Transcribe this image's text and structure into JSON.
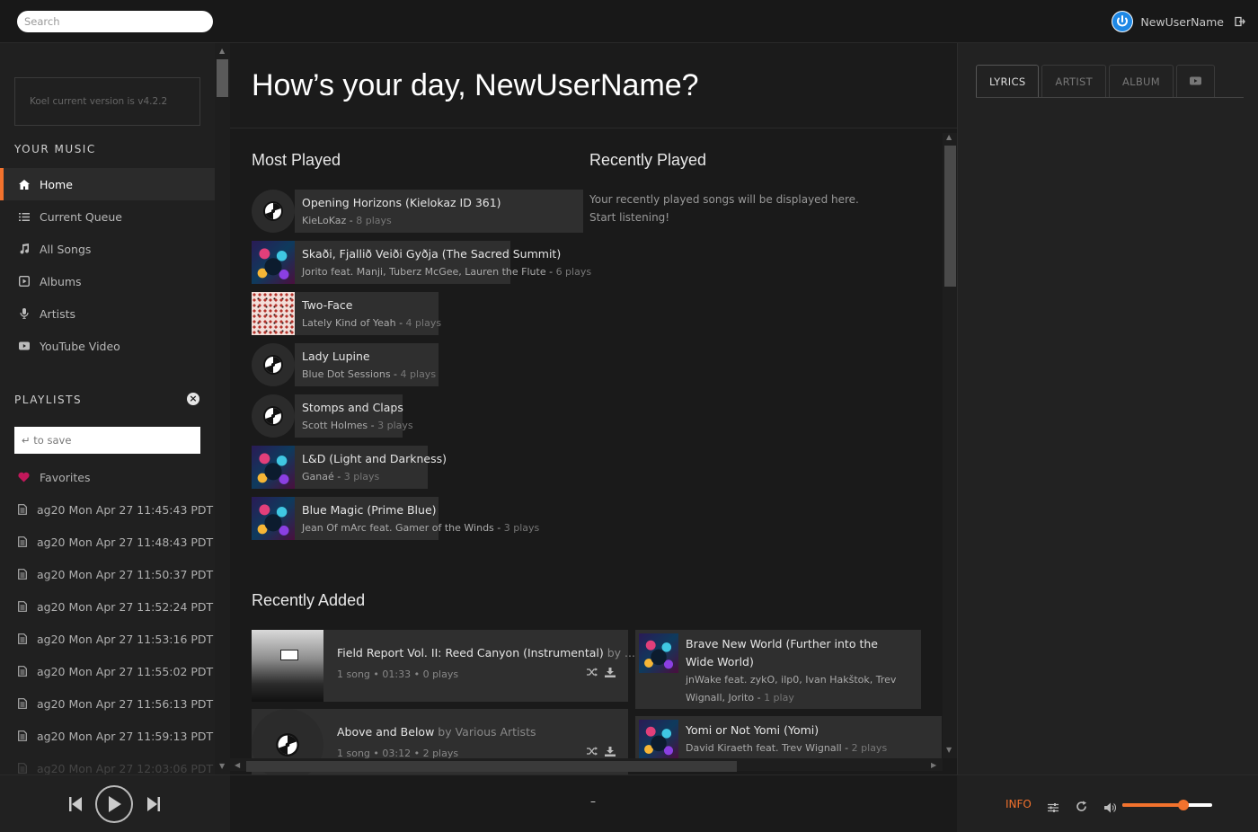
{
  "topbar": {
    "search_placeholder": "Search",
    "user_name": "NewUserName"
  },
  "sidebar": {
    "version_text": "Koel current version is v4.2.2",
    "your_music_heading": "YOUR MUSIC",
    "nav": [
      {
        "label": "Home",
        "icon": "home-icon",
        "active": true
      },
      {
        "label": "Current Queue",
        "icon": "queue-icon"
      },
      {
        "label": "All Songs",
        "icon": "music-note-icon"
      },
      {
        "label": "Albums",
        "icon": "album-icon"
      },
      {
        "label": "Artists",
        "icon": "microphone-icon"
      },
      {
        "label": "YouTube Video",
        "icon": "youtube-icon"
      }
    ],
    "playlists_heading": "PLAYLISTS",
    "playlist_input_placeholder": "↵ to save",
    "playlists": [
      {
        "label": "Favorites",
        "icon": "heart-icon"
      },
      {
        "label": "ag20 Mon Apr 27 11:45:43 PDT ...",
        "icon": "playlist-file-icon"
      },
      {
        "label": "ag20 Mon Apr 27 11:48:43 PDT ...",
        "icon": "playlist-file-icon"
      },
      {
        "label": "ag20 Mon Apr 27 11:50:37 PDT ...",
        "icon": "playlist-file-icon"
      },
      {
        "label": "ag20 Mon Apr 27 11:52:24 PDT ...",
        "icon": "playlist-file-icon"
      },
      {
        "label": "ag20 Mon Apr 27 11:53:16 PDT ...",
        "icon": "playlist-file-icon"
      },
      {
        "label": "ag20 Mon Apr 27 11:55:02 PDT ...",
        "icon": "playlist-file-icon"
      },
      {
        "label": "ag20 Mon Apr 27 11:56:13 PDT ...",
        "icon": "playlist-file-icon"
      },
      {
        "label": "ag20 Mon Apr 27 11:59:13 PDT ...",
        "icon": "playlist-file-icon"
      },
      {
        "label": "ag20 Mon Apr 27 12:03:06 PDT ...",
        "icon": "playlist-file-icon"
      }
    ]
  },
  "main": {
    "greeting": "How’s your day, NewUserName?",
    "most_played_heading": "Most Played",
    "recently_played_heading": "Recently Played",
    "recently_played_empty_line1": "Your recently played songs will be displayed here.",
    "recently_played_empty_line2": "Start listening!",
    "most_played": [
      {
        "title": "Opening Horizons (Kielokaz ID 361)",
        "artist": "KieLoKaz",
        "plays": "8 plays",
        "art": "vinyl"
      },
      {
        "title": "Skaði, Fjallið Veiði Gyðja (The Sacred Summit)",
        "artist": "Jorito feat. Manji, Tuberz McGee, Lauren the Flute",
        "plays": "6 plays",
        "art": "abstract"
      },
      {
        "title": "Two-Face",
        "artist": "Lately Kind of Yeah",
        "plays": "4 plays",
        "art": "pattern"
      },
      {
        "title": "Lady Lupine",
        "artist": "Blue Dot Sessions",
        "plays": "4 plays",
        "art": "vinyl"
      },
      {
        "title": "Stomps and Claps",
        "artist": "Scott Holmes",
        "plays": "3 plays",
        "art": "vinyl"
      },
      {
        "title": "L&D (Light and Darkness)",
        "artist": "Ganaé",
        "plays": "3 plays",
        "art": "abstract"
      },
      {
        "title": "Blue Magic (Prime Blue)",
        "artist": "Jean Of mArc feat. Gamer of the Winds",
        "plays": "3 plays",
        "art": "abstract"
      }
    ],
    "recently_added_heading": "Recently Added",
    "recently_added_albums": [
      {
        "title": "Field Report Vol. II: Reed Canyon (Instrumental)",
        "by": "by ...",
        "meta": "1 song • 01:33 • 0 plays",
        "art": "bw"
      },
      {
        "title": "Above and Below",
        "by": "by Various Artists",
        "meta": "1 song • 03:12 • 2 plays",
        "art": "vinyl"
      }
    ],
    "recently_added_songs": [
      {
        "title": "Brave New World (Further into the Wide World)",
        "artist": "jnWake feat. zykO, ilp0, Ivan Hakštok, Trev Wignall, Jorito",
        "plays": "1 play"
      },
      {
        "title": "Yomi or Not Yomi (Yomi)",
        "artist": "David Kiraeth feat. Trev Wignall",
        "plays": "2 plays"
      }
    ]
  },
  "right_panel": {
    "tabs": [
      {
        "label": "LYRICS",
        "active": true
      },
      {
        "label": "ARTIST"
      },
      {
        "label": "ALBUM"
      },
      {
        "label": "",
        "icon": "youtube-icon"
      }
    ]
  },
  "footer": {
    "track_placeholder": "–",
    "info_label": "INFO",
    "volume_fraction": 0.68,
    "accent_color": "#f2722d"
  }
}
